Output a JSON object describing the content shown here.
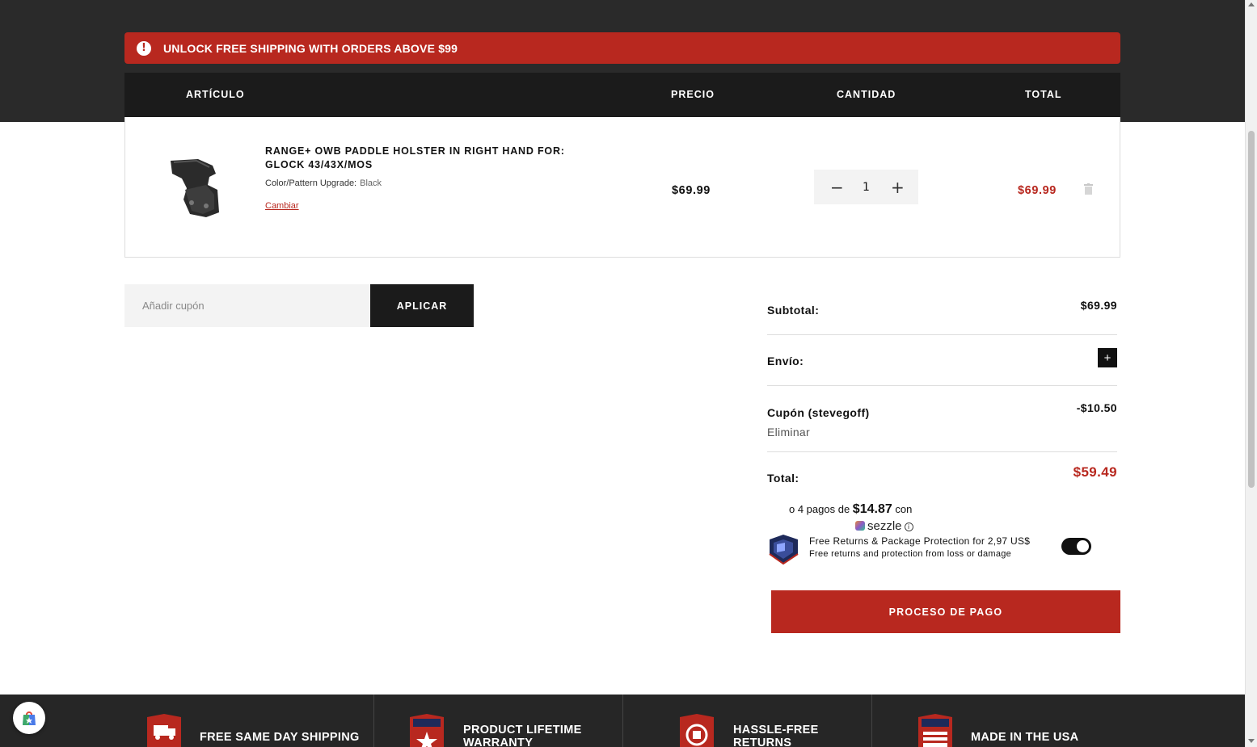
{
  "banner": {
    "text": "UNLOCK FREE SHIPPING WITH ORDERS ABOVE $99"
  },
  "table": {
    "headers": {
      "item": "ARTÍCULO",
      "price": "PRECIO",
      "quantity": "CANTIDAD",
      "total": "TOTAL"
    }
  },
  "cart_item": {
    "title": "RANGE+ OWB PADDLE HOLSTER IN RIGHT HAND FOR: GLOCK 43/43X/MOS",
    "variant_label": "Color/Pattern Upgrade:",
    "variant_value": "Black",
    "change_label": "Cambiar",
    "price": "$69.99",
    "quantity": "1",
    "line_total": "$69.99"
  },
  "coupon": {
    "placeholder": "Añadir cupón",
    "apply_label": "APLICAR"
  },
  "summary": {
    "subtotal_label": "Subtotal:",
    "subtotal_value": "$69.99",
    "shipping_label": "Envío:",
    "coupon_label": "Cupón (stevegoff)",
    "coupon_value": "-$10.50",
    "coupon_remove": "Eliminar",
    "total_label": "Total:",
    "total_value": "$59.49"
  },
  "sezzle": {
    "prefix": "o 4 pagos de ",
    "amount": "$14.87",
    "suffix": " con",
    "brand": "sezzle"
  },
  "protection": {
    "title": "Free Returns & Package Protection for 2,97 US$",
    "subtitle": "Free returns and protection from loss or damage",
    "enabled": true
  },
  "checkout": {
    "label": "PROCESO DE PAGO"
  },
  "footer_features": [
    {
      "label": "FREE SAME DAY SHIPPING"
    },
    {
      "label": "PRODUCT LIFETIME WARRANTY"
    },
    {
      "label": "HASSLE-FREE RETURNS"
    },
    {
      "label": "MADE IN THE USA"
    }
  ],
  "colors": {
    "accent": "#b8281f",
    "dark": "#1b1b1b",
    "band": "#2a2a2a",
    "footer": "#262626"
  }
}
